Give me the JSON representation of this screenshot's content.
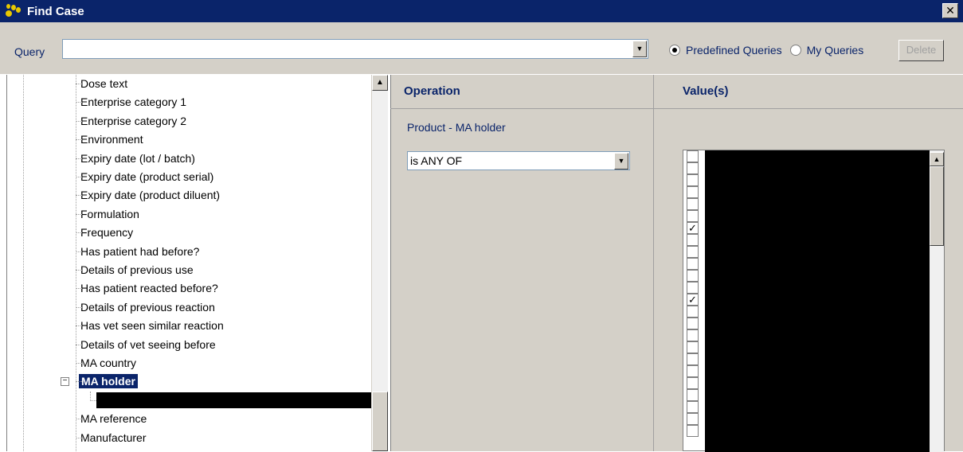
{
  "window": {
    "title": "Find Case",
    "close_glyph": "✕"
  },
  "query_bar": {
    "label": "Query",
    "value": "",
    "radio_predefined": "Predefined Queries",
    "radio_my": "My Queries",
    "selected_radio": "Predefined Queries",
    "delete_label": "Delete"
  },
  "tree": {
    "items": [
      "Dose text",
      "Enterprise category 1",
      "Enterprise category 2",
      "Environment",
      "Expiry date (lot / batch)",
      "Expiry date (product serial)",
      "Expiry date (product diluent)",
      "Formulation",
      "Frequency",
      "Has patient had before?",
      "Details of previous use",
      "Has patient reacted before?",
      "Details of previous reaction",
      "Has vet seen similar reaction",
      "Details of vet seeing before",
      "MA country",
      "MA holder",
      "MA reference",
      "Manufacturer"
    ],
    "selected": "MA holder",
    "expander_glyph": "−"
  },
  "operation": {
    "header": "Operation",
    "field_label": "Product - MA holder",
    "selected_operation": "is ANY OF"
  },
  "values": {
    "header": "Value(s)",
    "checked_rows": [
      6,
      12
    ],
    "row_count": 24
  },
  "icons": {
    "combo_arrow": "▼",
    "scroll_up": "▲"
  },
  "colors": {
    "title_bg": "#0a246a",
    "selection": "#0a246a",
    "panel": "#d4d0c8"
  }
}
